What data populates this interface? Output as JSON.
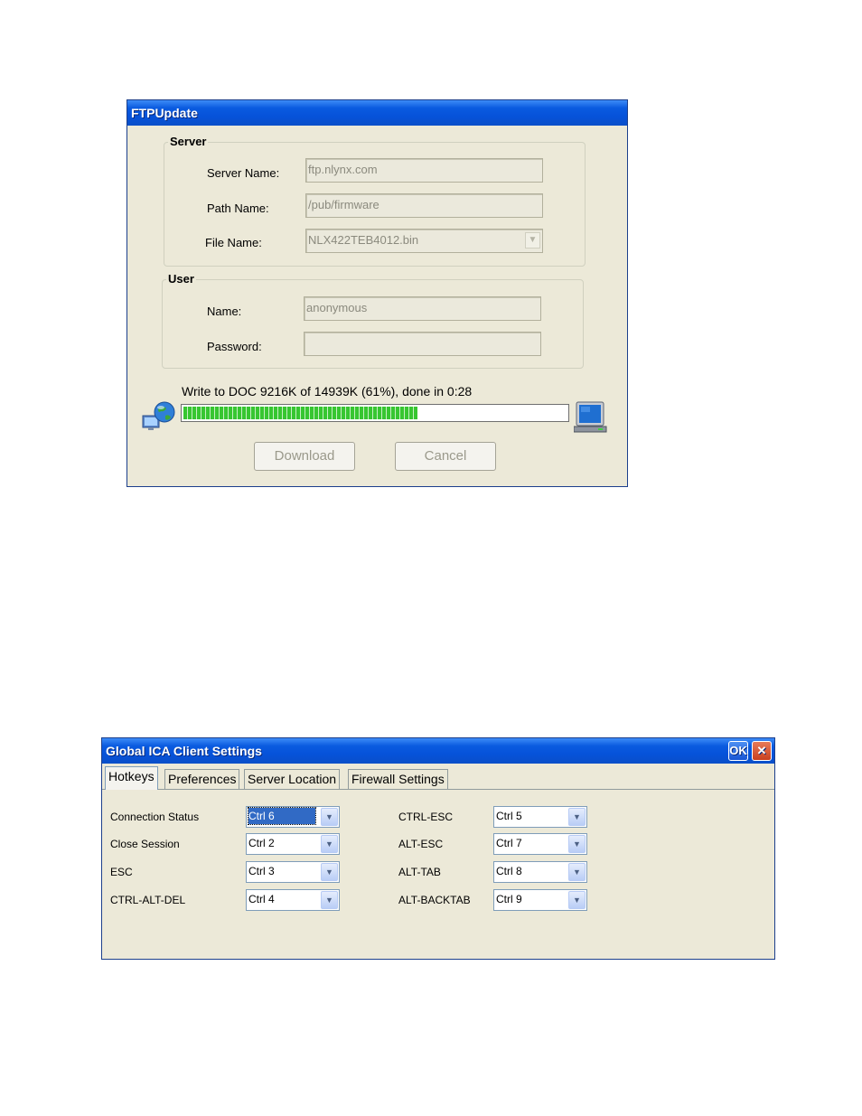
{
  "ftp_window": {
    "title": "FTPUpdate",
    "server_group": {
      "label": "Server",
      "server_name_label": "Server Name:",
      "server_name_value": "ftp.nlynx.com",
      "path_name_label": "Path Name:",
      "path_name_value": "/pub/firmware",
      "file_name_label": "File Name:",
      "file_name_value": "NLX422TEB4012.bin"
    },
    "user_group": {
      "label": "User",
      "name_label": "Name:",
      "name_value": "anonymous",
      "password_label": "Password:",
      "password_value": ""
    },
    "status_text": "Write to DOC 9216K of 14939K (61%), done in 0:28",
    "progress_percent": 61,
    "icons": {
      "left": "network-globe-icon",
      "right": "computer-monitor-icon"
    },
    "download_label": "Download",
    "cancel_label": "Cancel"
  },
  "ica_window": {
    "title": "Global ICA Client Settings",
    "ok_label": "OK",
    "close_label": "✕",
    "tabs": [
      "Hotkeys",
      "Preferences",
      "Server Location",
      "Firewall Settings"
    ],
    "active_tab": "Hotkeys",
    "hotkeys_left": [
      {
        "label": "Connection Status",
        "value": "Ctrl 6"
      },
      {
        "label": "Close Session",
        "value": "Ctrl 2"
      },
      {
        "label": "ESC",
        "value": "Ctrl 3"
      },
      {
        "label": "CTRL-ALT-DEL",
        "value": "Ctrl 4"
      }
    ],
    "hotkeys_right": [
      {
        "label": "CTRL-ESC",
        "value": "Ctrl 5"
      },
      {
        "label": "ALT-ESC",
        "value": "Ctrl 7"
      },
      {
        "label": "ALT-TAB",
        "value": "Ctrl 8"
      },
      {
        "label": "ALT-BACKTAB",
        "value": "Ctrl 9"
      }
    ]
  }
}
